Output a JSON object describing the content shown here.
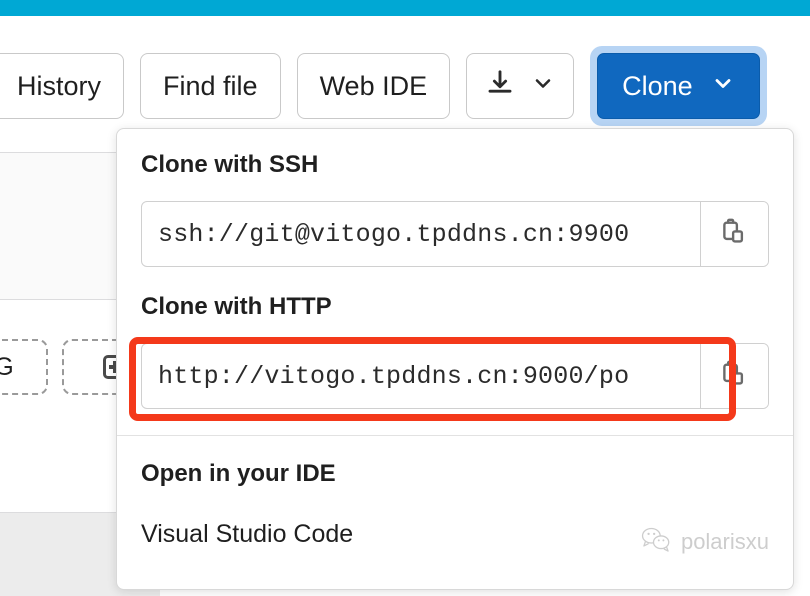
{
  "accent": {
    "teal_bar": "#00a8d4",
    "primary_button": "#1068bf",
    "focus_ring": "#b7d4f4",
    "annotation_red": "#f4391a"
  },
  "toolbar": {
    "history_label": "History",
    "find_file_label": "Find file",
    "web_ide_label": "Web IDE",
    "download_icon": "download-icon",
    "download_chevron_icon": "chevron-down-icon",
    "clone_label": "Clone",
    "clone_chevron_icon": "chevron-down-icon"
  },
  "background": {
    "chip_label": "NG",
    "chip_add_icon": "plus-square-icon"
  },
  "clone_dropdown": {
    "ssh": {
      "heading": "Clone with SSH",
      "url": "ssh://git@vitogo.tpddns.cn:9900",
      "copy_icon": "copy-clipboard-icon"
    },
    "http": {
      "heading": "Clone with HTTP",
      "url": "http://vitogo.tpddns.cn:9000/po",
      "copy_icon": "copy-clipboard-icon"
    },
    "ide": {
      "heading": "Open in your IDE",
      "items": [
        {
          "label": "Visual Studio Code"
        }
      ]
    }
  },
  "watermark": {
    "icon": "wechat-icon",
    "text": "polarisxu"
  }
}
